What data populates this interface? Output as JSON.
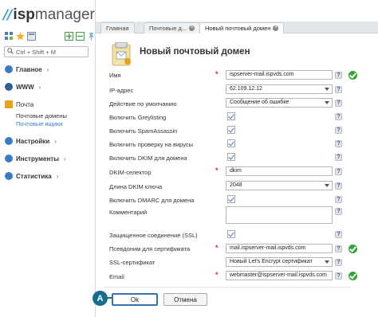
{
  "app": {
    "logo_mark": "//",
    "logo_bold": "isp",
    "logo_rest": "manager"
  },
  "search": {
    "placeholder": "Ctrl + Shift + M"
  },
  "nav": {
    "items": [
      {
        "label": "Главное",
        "icon": "globe-icon",
        "color": "#3a7cc1"
      },
      {
        "label": "WWW",
        "icon": "globe-icon",
        "color": "#3a7cc1"
      },
      {
        "label": "Почта",
        "icon": "mail-folder-icon",
        "color": "#e6a21a"
      },
      {
        "label": "Настройки",
        "icon": "settings-icon",
        "color": "#3a7cc1"
      },
      {
        "label": "Инструменты",
        "icon": "tools-icon",
        "color": "#3a7cc1"
      },
      {
        "label": "Статистика",
        "icon": "chart-icon",
        "color": "#3a7cc1"
      }
    ],
    "mail_sub": [
      "Почтовые домены",
      "Почтовые ящики"
    ]
  },
  "tabs": [
    {
      "label": "Главная"
    },
    {
      "label": "Почтовые д..."
    },
    {
      "label": "Новый почтовый домен"
    }
  ],
  "form": {
    "title": "Новый почтовый домен",
    "fields": {
      "name": {
        "label": "Имя",
        "value": "ispserver-mail.ispvds.com"
      },
      "ip": {
        "label": "IP-адрес",
        "value": "62.109.12.12"
      },
      "default_action": {
        "label": "Действие по умолчанию",
        "value": "Сообщение об ошибке"
      },
      "greylisting": {
        "label": "Включить Greylisting"
      },
      "spamassassin": {
        "label": "Включить SpamAssassin"
      },
      "virus_check": {
        "label": "Включить проверку на вирусы"
      },
      "dkim": {
        "label": "Включить DKIM для домена"
      },
      "dkim_selector": {
        "label": "DKIM-селектор",
        "value": "dkim"
      },
      "dkim_key_len": {
        "label": "Длина DKIM ключа",
        "value": "2048"
      },
      "dmarc": {
        "label": "Включить DMARC для домена"
      },
      "comment": {
        "label": "Комментарий",
        "value": ""
      },
      "ssl": {
        "label": "Защищенное соединение (SSL)"
      },
      "cert_alias": {
        "label": "Псевдоним для сертификата",
        "value": "mail.ispserver-mail.ispvds.com"
      },
      "ssl_cert": {
        "label": "SSL-сертификат",
        "value": "Новый Let's Encrypt сертификат"
      },
      "email": {
        "label": "Email",
        "value": "webmaster@ispserver-mail.ispvds.com"
      }
    },
    "hint_glyph": "?",
    "ok_label": "Ok",
    "cancel_label": "Отмена",
    "annotation_badge": "A"
  },
  "colors": {
    "accent": "#3a7cc1",
    "required": "#e0203a",
    "success": "#33a532",
    "badge": "#176d8c"
  }
}
